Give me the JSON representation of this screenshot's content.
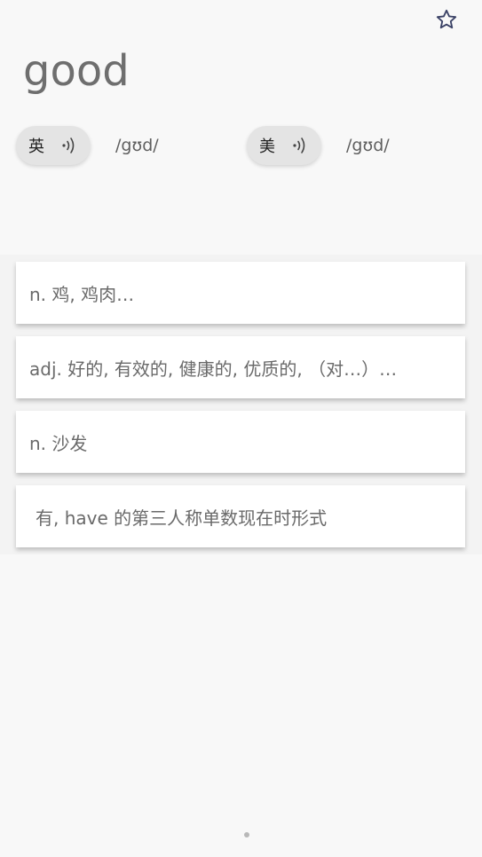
{
  "header": {
    "favorite_icon": "star-outline-icon"
  },
  "word": "good",
  "pronunciations": [
    {
      "label": "英",
      "phonetic": "/gʊd/",
      "icon": "speaker-icon"
    },
    {
      "label": "美",
      "phonetic": "/gʊd/",
      "icon": "speaker-icon"
    }
  ],
  "definitions": [
    "n. 鸡, 鸡肉…",
    "adj. 好的, 有效的, 健康的, 优质的, （对…）…",
    "n. 沙发",
    "有, have 的第三人称单数现在时形式"
  ],
  "pager": {
    "dot_color": "#b8b8b8"
  },
  "colors": {
    "background": "#f8f8f8",
    "card": "#ffffff",
    "pill": "#e4e4e4",
    "star": "#3b4266"
  }
}
